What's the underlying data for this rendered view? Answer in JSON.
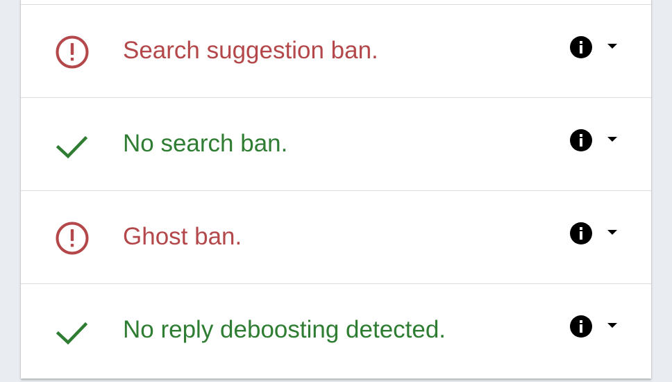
{
  "colors": {
    "fail": "#b3474a",
    "pass": "#2e7d32"
  },
  "results": [
    {
      "status": "fail",
      "icon": "alert-circle-icon",
      "text": "Search suggestion ban."
    },
    {
      "status": "pass",
      "icon": "check-icon",
      "text": "No search ban."
    },
    {
      "status": "fail",
      "icon": "alert-circle-icon",
      "text": "Ghost ban."
    },
    {
      "status": "pass",
      "icon": "check-icon",
      "text": "No reply deboosting detected."
    }
  ]
}
